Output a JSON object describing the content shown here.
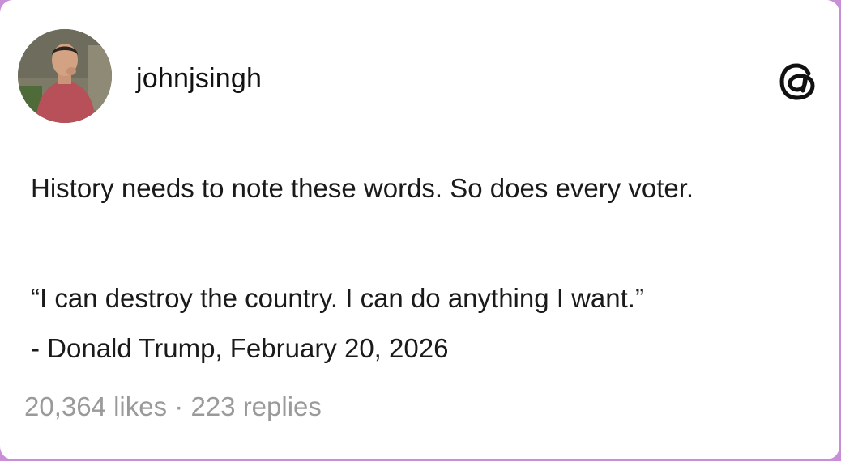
{
  "post": {
    "username": "johnjsingh",
    "text": "History needs to note these words. So does every voter.",
    "quote_line": "“I can destroy the country. I can do anything I want.”",
    "attribution": "- Donald Trump, February 20, 2026",
    "likes": "20,364 likes",
    "separator": "·",
    "replies": "223 replies"
  },
  "icons": {
    "avatar": "profile-avatar",
    "app_logo": "threads-logo-icon"
  },
  "colors": {
    "background_frame": "#c98fd6",
    "card": "#ffffff",
    "text": "#1a1a1a",
    "muted": "#9a9a9a"
  }
}
